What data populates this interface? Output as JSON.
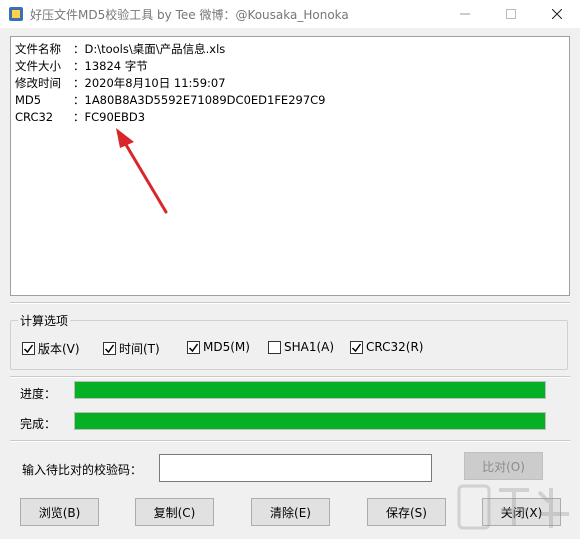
{
  "window": {
    "title": "好压文件MD5校验工具 by Tee    微博：@Kousaka_Honoka"
  },
  "output": {
    "lines": [
      {
        "label": "文件名称",
        "sep": "：",
        "value": "D:\\tools\\桌面\\产品信息.xls"
      },
      {
        "label": "文件大小",
        "sep": "：",
        "value": "13824 字节"
      },
      {
        "label": "修改时间",
        "sep": "：",
        "value": "2020年8月10日 11:59:07"
      },
      {
        "label": "MD5",
        "sep": "：",
        "value": "1A80B8A3D5592E71089DC0ED1FE297C9"
      },
      {
        "label": "CRC32",
        "sep": "：",
        "value": "FC90EBD3"
      }
    ]
  },
  "options": {
    "legend": "计算选项",
    "checkboxes": [
      {
        "label": "版本(V)",
        "checked": true
      },
      {
        "label": "时间(T)",
        "checked": true
      },
      {
        "label": "MD5(M)",
        "checked": true
      },
      {
        "label": "SHA1(A)",
        "checked": false
      },
      {
        "label": "CRC32(R)",
        "checked": true
      }
    ]
  },
  "progress": {
    "label": "进度：",
    "value": 1.0
  },
  "complete": {
    "label": "完成：",
    "value": 1.0
  },
  "compare": {
    "label": "输入待比对的校验码：",
    "value": "",
    "button": "比对(O)"
  },
  "buttons": {
    "browse": "浏览(B)",
    "copy": "复制(C)",
    "clear": "清除(E)",
    "save": "保存(S)",
    "close": "关闭(X)"
  },
  "colors": {
    "progress_fill": "#06b025",
    "arrow": "#d9262b"
  }
}
